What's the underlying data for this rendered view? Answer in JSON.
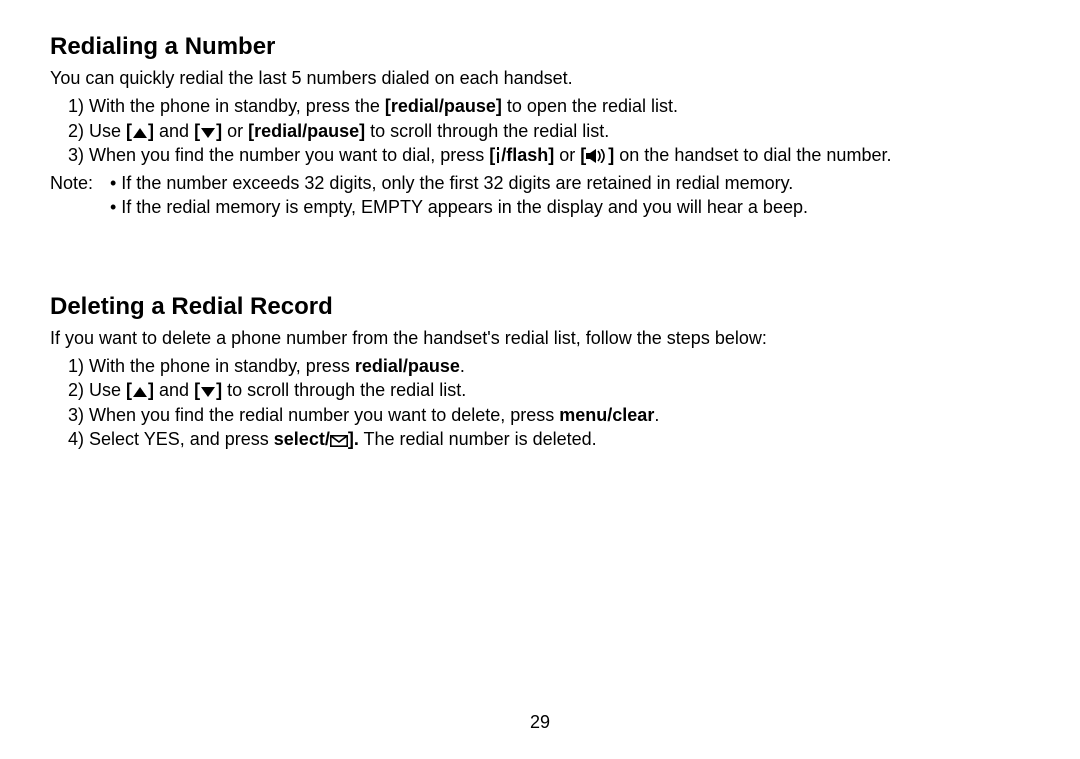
{
  "page_number": "29",
  "section1": {
    "heading": "Redialing a Number",
    "intro": "You can quickly redial the last 5 numbers dialed on each handset.",
    "step1_prefix": "1) With the phone in standby, press the ",
    "redial_pause_b": "[redial/pause]",
    "step1_suffix": " to open the redial list.",
    "step2_prefix": "2) Use ",
    "open_bracket": "[",
    "close_bracket": "]",
    "and_word": " and ",
    "or_word": " or ",
    "redial_pause_b2": "[redial/pause]",
    "step2_suffix": " to scroll through the redial list.",
    "step3_prefix": "3) When you find the number you want to dial, press ",
    "flash_b_open": "[",
    "flash_b_text": "/flash]",
    "step3_mid": " or ",
    "speaker_b_post": "",
    "step3_suffix": " on the handset to dial the number.",
    "note_label": "Note:",
    "note1": "• If the number exceeds 32 digits, only the first 32 digits are retained in redial memory.",
    "note2": "• If the redial memory is empty, EMPTY appears in the display and you will hear a beep."
  },
  "section2": {
    "heading": "Deleting a Redial Record",
    "intro": "If you want to delete a phone number from the handset's redial list, follow the steps below:",
    "step1_prefix": "1) With the phone in standby, press ",
    "redial_pause_b": "redial/pause",
    "step1_suffix": ".",
    "step2_prefix": "2) Use ",
    "step2_suffix": " to scroll through the redial list.",
    "step3_prefix": "3) When you find the redial number you want to delete, press ",
    "menu_clear_b": "menu/clear",
    "step3_suffix": ".",
    "step4_prefix": "4) Select YES, and press ",
    "select_b_prefix": "select/",
    "step4_suffix": " The redial number is deleted.",
    "period_after_icon": "."
  }
}
